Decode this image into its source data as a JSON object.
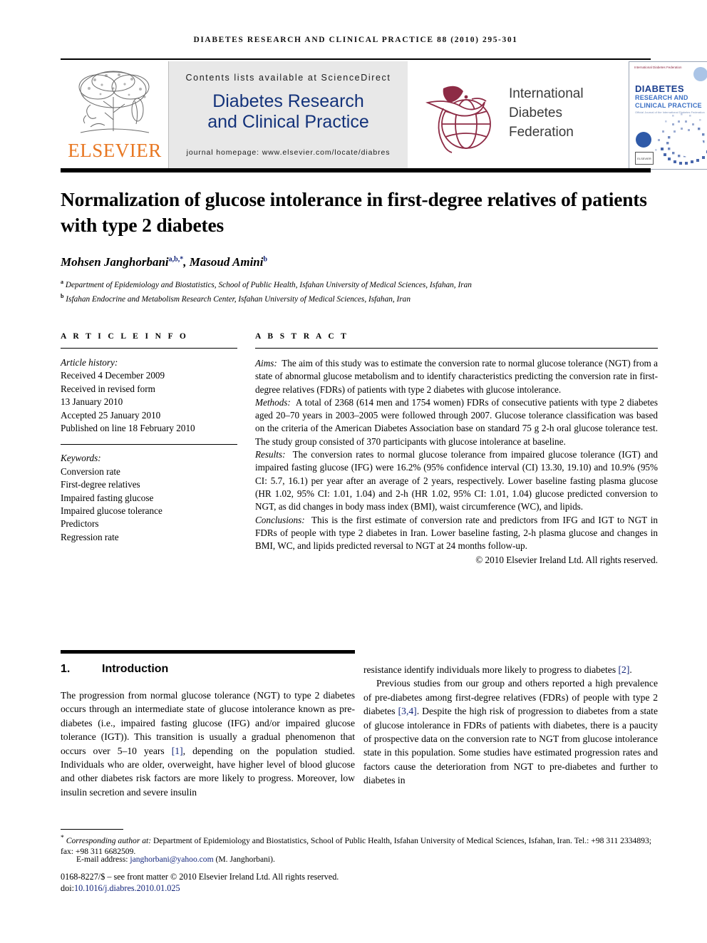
{
  "running_head": "DIABETES RESEARCH AND CLINICAL PRACTICE 88 (2010) 295-301",
  "header": {
    "elsevier_wordmark": "ELSEVIER",
    "elsevier_orange": "#E87722",
    "sciencedirect": {
      "contents_line": "Contents lists available at ScienceDirect",
      "journal_title_line1": "Diabetes Research",
      "journal_title_line2": "and Clinical Practice",
      "homepage": "journal homepage: www.elsevier.com/locate/diabres",
      "title_color": "#13327a",
      "box_color": "#e8e8e8"
    },
    "idf": {
      "line1": "International",
      "line2": "Diabetes",
      "line3": "Federation",
      "mark_color": "#8d2b45"
    },
    "cover": {
      "idf_mark_text": "International Diabetes Federation",
      "title": "DIABETES",
      "sub1": "RESEARCH AND",
      "sub2": "CLINICAL PRACTICE",
      "tagline": "Official Journal of the International Diabetes Federation",
      "publisher": "ELSEVIER",
      "accent_color": "#1b3f8f"
    }
  },
  "article": {
    "title": "Normalization of glucose intolerance in first-degree relatives of patients with type 2 diabetes",
    "authors_html": "Mohsen Janghorbani<sup>a,b,*</sup>, Masoud Amini<sup>b</sup>",
    "affiliation_a": "Department of Epidemiology and Biostatistics, School of Public Health, Isfahan University of Medical Sciences, Isfahan, Iran",
    "affiliation_b": "Isfahan Endocrine and Metabolism Research Center, Isfahan University of Medical Sciences, Isfahan, Iran"
  },
  "article_info": {
    "heading": "A R T I C L E  I N F O",
    "history_label": "Article history:",
    "history": [
      "Received 4 December 2009",
      "Received in revised form",
      "13 January 2010",
      "Accepted 25 January 2010",
      "Published on line 18 February 2010"
    ],
    "keywords_label": "Keywords:",
    "keywords": [
      "Conversion rate",
      "First-degree relatives",
      "Impaired fasting glucose",
      "Impaired glucose tolerance",
      "Predictors",
      "Regression rate"
    ]
  },
  "abstract": {
    "heading": "A B S T R A C T",
    "aims_label": "Aims:",
    "aims_text": "The aim of this study was to estimate the conversion rate to normal glucose tolerance (NGT) from a state of abnormal glucose metabolism and to identify characteristics predicting the conversion rate in first-degree relatives (FDRs) of patients with type 2 diabetes with glucose intolerance.",
    "methods_label": "Methods:",
    "methods_text": "A total of 2368 (614 men and 1754 women) FDRs of consecutive patients with type 2 diabetes aged 20–70 years in 2003–2005 were followed through 2007. Glucose tolerance classification was based on the criteria of the American Diabetes Association base on standard 75 g 2-h oral glucose tolerance test. The study group consisted of 370 participants with glucose intolerance at baseline.",
    "results_label": "Results:",
    "results_text": "The conversion rates to normal glucose tolerance from impaired glucose tolerance (IGT) and impaired fasting glucose (IFG) were 16.2% (95% confidence interval (CI) 13.30, 19.10) and 10.9% (95% CI: 5.7, 16.1) per year after an average of 2 years, respectively. Lower baseline fasting plasma glucose (HR 1.02, 95% CI: 1.01, 1.04) and 2-h (HR 1.02, 95% CI: 1.01, 1.04) glucose predicted conversion to NGT, as did changes in body mass index (BMI), waist circumference (WC), and lipids.",
    "conclusions_label": "Conclusions:",
    "conclusions_text": "This is the first estimate of conversion rate and predictors from IFG and IGT to NGT in FDRs of people with type 2 diabetes in Iran. Lower baseline fasting, 2-h plasma glucose and changes in BMI, WC, and lipids predicted reversal to NGT at 24 months follow-up.",
    "copyright": "© 2010 Elsevier Ireland Ltd. All rights reserved."
  },
  "introduction": {
    "number": "1.",
    "heading": "Introduction",
    "left_p1_a": "The progression from normal glucose tolerance (NGT) to type 2 diabetes occurs through an intermediate state of glucose intolerance known as pre-diabetes (i.e., impaired fasting glucose (IFG) and/or impaired glucose tolerance (IGT)). This transition is usually a gradual phenomenon that occurs over 5–10 years ",
    "left_ref1": "[1]",
    "left_p1_b": ", depending on the population studied. Individuals who are older, overweight, have higher level of blood glucose and other diabetes risk factors are more likely to progress. Moreover, low insulin secretion and severe insulin ",
    "right_p1_a": "resistance identify individuals more likely to progress to diabetes ",
    "right_ref2": "[2]",
    "right_p1_b": ".",
    "right_p2_a": "Previous studies from our group and others reported a high prevalence of pre-diabetes among first-degree relatives (FDRs) of people with type 2 diabetes ",
    "right_ref34": "[3,4]",
    "right_p2_b": ". Despite the high risk of progression to diabetes from a state of glucose intolerance in FDRs of patients with diabetes, there is a paucity of prospective data on the conversion rate to NGT from glucose intolerance state in this population. Some studies have estimated progression rates and factors cause the deterioration from NGT to pre-diabetes and further to diabetes in"
  },
  "footnotes": {
    "corresponding_marker": "*",
    "corresponding_label": "Corresponding author at:",
    "corresponding_text": " Department of Epidemiology and Biostatistics, School of Public Health, Isfahan University of Medical Sciences, Isfahan, Iran. Tel.: +98 311 2334893; fax: +98 311 6682509.",
    "email_label": "E-mail address:",
    "email": "janghorbani@yahoo.com",
    "email_suffix": " (M. Janghorbani).",
    "front_matter": "0168-8227/$ – see front matter © 2010 Elsevier Ireland Ltd. All rights reserved.",
    "doi_label": "doi:",
    "doi": "10.1016/j.diabres.2010.01.025"
  }
}
